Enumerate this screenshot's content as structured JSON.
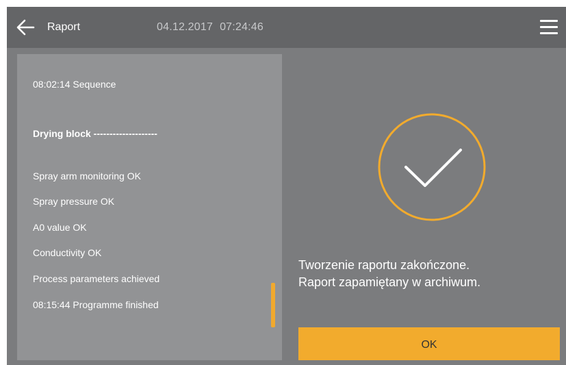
{
  "header": {
    "title": "Raport",
    "date": "04.12.2017",
    "time": "07:24:46",
    "back_icon": "arrow-left-icon",
    "menu_icon": "hamburger-menu-icon"
  },
  "log": {
    "lines": [
      "08:02:14 Sequence",
      "Drying block --------------------",
      "Spray arm monitoring OK",
      "Spray pressure OK",
      "A0 value OK",
      "Conductivity OK",
      "Process parameters achieved",
      "08:15:44 Programme finished"
    ],
    "heading_line_index": 1
  },
  "status": {
    "icon": "checkmark-circle-icon",
    "message_line1": "Tworzenie raportu zakończone.",
    "message_line2": "Raport zapamiętany w archiwum."
  },
  "actions": {
    "ok_label": "OK"
  },
  "colors": {
    "accent": "#f2ab2d",
    "background": "#7b7c7e",
    "header": "#646567",
    "panel": "#929395",
    "text": "#ffffff"
  }
}
